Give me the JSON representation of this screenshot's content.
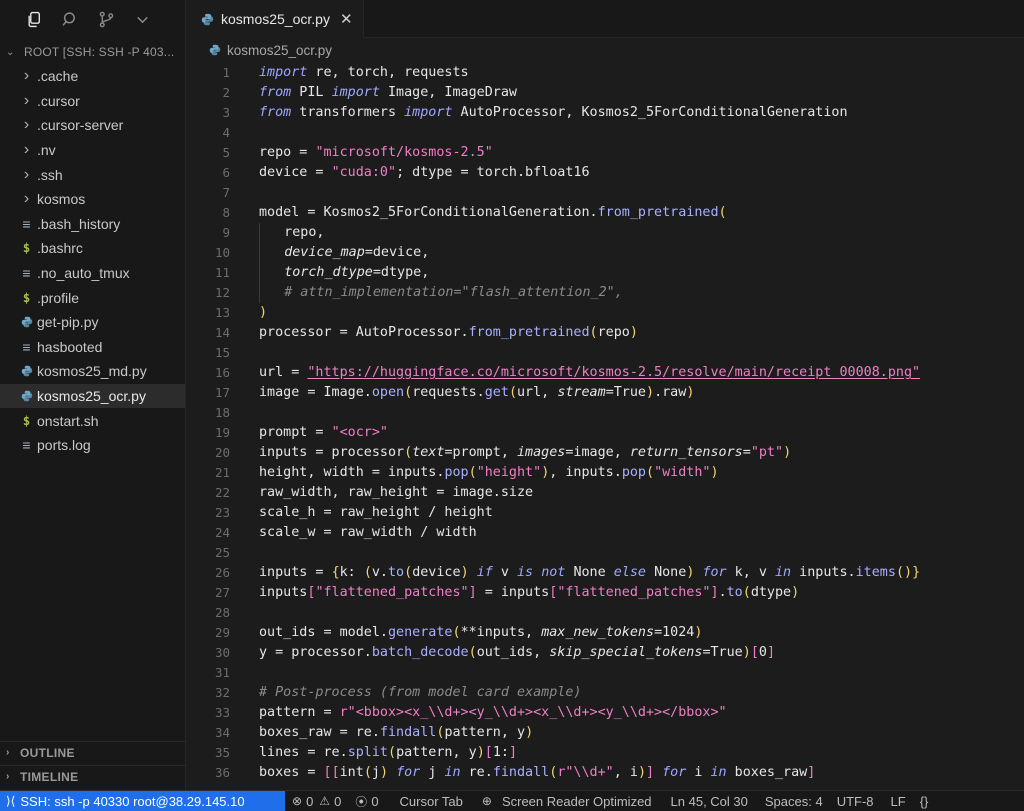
{
  "sidebar": {
    "root_label": "ROOT [SSH: SSH -P 403...",
    "items": [
      {
        "label": ".cache",
        "kind": "folder"
      },
      {
        "label": ".cursor",
        "kind": "folder"
      },
      {
        "label": ".cursor-server",
        "kind": "folder"
      },
      {
        "label": ".nv",
        "kind": "folder"
      },
      {
        "label": ".ssh",
        "kind": "folder"
      },
      {
        "label": "kosmos",
        "kind": "folder"
      },
      {
        "label": ".bash_history",
        "kind": "lines"
      },
      {
        "label": ".bashrc",
        "kind": "dollar"
      },
      {
        "label": ".no_auto_tmux",
        "kind": "lines"
      },
      {
        "label": ".profile",
        "kind": "dollar"
      },
      {
        "label": "get-pip.py",
        "kind": "python"
      },
      {
        "label": "hasbooted",
        "kind": "lines"
      },
      {
        "label": "kosmos25_md.py",
        "kind": "python"
      },
      {
        "label": "kosmos25_ocr.py",
        "kind": "python",
        "selected": true
      },
      {
        "label": "onstart.sh",
        "kind": "dollar"
      },
      {
        "label": "ports.log",
        "kind": "lines"
      }
    ],
    "outline_label": "OUTLINE",
    "timeline_label": "TIMELINE"
  },
  "editor": {
    "tab_label": "kosmos25_ocr.py",
    "close_glyph": "✕",
    "breadcrumb": "kosmos25_ocr.py"
  },
  "code_lines": [
    "import re, torch, requests",
    "from PIL import Image, ImageDraw",
    "from transformers import AutoProcessor, Kosmos2_5ForConditionalGeneration",
    "",
    "repo = \"microsoft/kosmos-2.5\"",
    "device = \"cuda:0\"; dtype = torch.bfloat16",
    "",
    "model = Kosmos2_5ForConditionalGeneration.from_pretrained(",
    "    repo,",
    "    device_map=device,",
    "    torch_dtype=dtype,",
    "    # attn_implementation=\"flash_attention_2\",",
    ")",
    "processor = AutoProcessor.from_pretrained(repo)",
    "",
    "url = \"https://huggingface.co/microsoft/kosmos-2.5/resolve/main/receipt_00008.png\"",
    "image = Image.open(requests.get(url, stream=True).raw)",
    "",
    "prompt = \"<ocr>\"",
    "inputs = processor(text=prompt, images=image, return_tensors=\"pt\")",
    "height, width = inputs.pop(\"height\"), inputs.pop(\"width\")",
    "raw_width, raw_height = image.size",
    "scale_h = raw_height / height",
    "scale_w = raw_width / width",
    "",
    "inputs = {k: (v.to(device) if v is not None else None) for k, v in inputs.items()}",
    "inputs[\"flattened_patches\"] = inputs[\"flattened_patches\"].to(dtype)",
    "",
    "out_ids = model.generate(**inputs, max_new_tokens=1024)",
    "y = processor.batch_decode(out_ids, skip_special_tokens=True)[0]",
    "",
    "# Post-process (from model card example)",
    "pattern = r\"<bbox><x_\\\\d+><y_\\\\d+><x_\\\\d+><y_\\\\d+></bbox>\"",
    "boxes_raw = re.findall(pattern, y)",
    "lines = re.split(pattern, y)[1:]",
    "boxes = [[int(j) for j in re.findall(r\"\\\\d+\", i)] for i in boxes_raw]"
  ],
  "statusbar": {
    "remote": "SSH: ssh -p 40330 root@38.29.145.10",
    "errors": "0",
    "warnings": "0",
    "ports": "0",
    "cursor_tab": "Cursor Tab",
    "screen_reader": "Screen Reader Optimized",
    "position": "Ln 45, Col 30",
    "spaces": "Spaces: 4",
    "encoding": "UTF-8",
    "eol": "LF",
    "language": "{}"
  },
  "colors": {
    "accent": "#1f6feb",
    "keyword": "#9fa8ff",
    "string": "#ef7fc6",
    "comment": "#8a8a8a",
    "control_keyword": "#f3d774"
  }
}
